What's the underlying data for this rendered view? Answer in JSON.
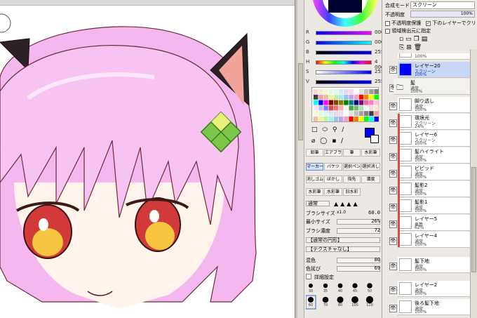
{
  "colors": {
    "main_color": "#0000ff",
    "selected_layer_bg": "#c9d6f6",
    "clip_marker": "#e04848"
  },
  "sliders": [
    {
      "label": "R",
      "value": "000"
    },
    {
      "label": "G",
      "value": "000"
    },
    {
      "label": "B",
      "value": "255"
    },
    {
      "label": "H",
      "value": "4 000"
    },
    {
      "label": "S",
      "value": "255"
    },
    {
      "label": "V",
      "value": "255"
    }
  ],
  "tools": {
    "row1": [
      "鉛筆",
      "エアブラシ",
      "筆",
      "水彩筆"
    ],
    "row2": [
      "マーカー",
      "バケツ",
      "選択ペン",
      "選択消し"
    ],
    "row3": [
      "消しゴム",
      "ぼかし",
      "指先",
      "濃度"
    ],
    "row4": [
      "水彩筆",
      "水彩筆",
      "旧水彩"
    ]
  },
  "brush": {
    "shape_select": "通常",
    "size_label": "ブラシサイズ",
    "size_multiplier": "x1.0",
    "size_value": "60.0",
    "min_size_label": "最小サイズ",
    "min_size_value": "26%",
    "density_label": "ブラシ濃度",
    "density_value": "72",
    "shape_dropdown": "【通常の円形】",
    "texture_dropdown": "【テクスチャなし】",
    "mix_label": "混色",
    "mix_value": "80",
    "extend_label": "色延び",
    "extend_value": "69",
    "detail_label": "詳細設定",
    "dot_sizes_row1": [
      "30",
      "35",
      "40",
      "45",
      "50"
    ],
    "dot_sizes_row2": [
      "60",
      "70",
      "80",
      "100",
      "120"
    ]
  },
  "layer_props": {
    "blend_label": "合成モード",
    "blend_value": "スクリーン",
    "opacity_label": "不透明度",
    "opacity_value": "100%",
    "protect_label": "不透明度保護",
    "clip_label": "下のレイヤーでクリッピング",
    "source_label": "領域検出元に指定"
  },
  "layers": [
    {
      "name": "",
      "mode": "",
      "opacity": "100%",
      "selected": false
    },
    {
      "name": "レイヤー20",
      "mode": "スクリーン",
      "opacity": "100%",
      "selected": true
    },
    {
      "name": "髪",
      "mode": "通常",
      "opacity": "100%",
      "selected": false,
      "folder": true
    },
    {
      "name": "脚り透し",
      "mode": "通常",
      "opacity": "100%",
      "selected": false
    },
    {
      "name": "環境光",
      "mode": "スクリーン",
      "opacity": "24%",
      "selected": false
    },
    {
      "name": "レイヤー6",
      "mode": "スクリーン",
      "opacity": "100%",
      "selected": false
    },
    {
      "name": "髪ハイライト",
      "mode": "通常",
      "opacity": "100%",
      "selected": false
    },
    {
      "name": "ビビッド",
      "mode": "通常",
      "opacity": "100%",
      "selected": false
    },
    {
      "name": "髪影2",
      "mode": "通常",
      "opacity": "100%",
      "selected": false
    },
    {
      "name": "髪影1",
      "mode": "通常",
      "opacity": "100%",
      "selected": false
    },
    {
      "name": "レイヤー5",
      "mode": "乗算",
      "opacity": "62%",
      "selected": false
    },
    {
      "name": "レイヤー4",
      "mode": "通常",
      "opacity": "100%",
      "selected": false
    },
    {
      "name": "髪下地",
      "mode": "通常",
      "opacity": "100%",
      "selected": false
    },
    {
      "name": "レイヤー2",
      "mode": "通常",
      "opacity": "100%",
      "selected": false
    },
    {
      "name": "後ろ髪下地",
      "mode": "通常",
      "opacity": "100%",
      "selected": false
    }
  ]
}
